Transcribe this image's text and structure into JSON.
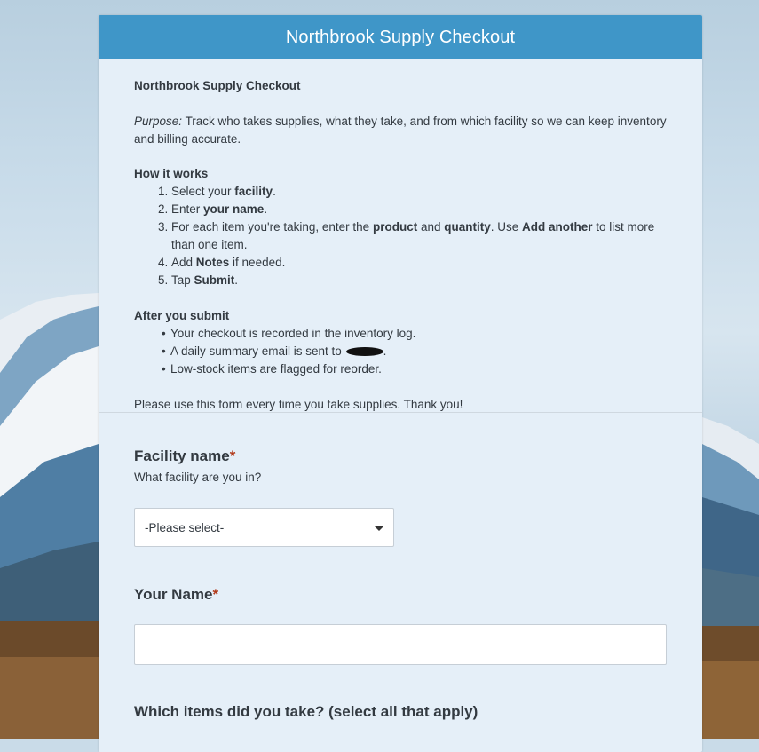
{
  "form": {
    "header_title": "Northbrook Supply Checkout",
    "intro": {
      "title": "Northbrook Supply Checkout",
      "purpose_label": "Purpose:",
      "purpose_text": "Track who takes supplies, what they take, and from which facility so we can keep inventory and billing accurate.",
      "how_title": "How it works",
      "steps": [
        {
          "pre": "Select your ",
          "bold": "facility",
          "post": "."
        },
        {
          "pre": "Enter ",
          "bold": "your name",
          "post": "."
        },
        {
          "pre": "For each item you're taking, enter the ",
          "bold": "product",
          "mid": " and ",
          "bold2": "quantity",
          "mid2": ". Use ",
          "bold3": "Add another",
          "post": " to list more than one item."
        },
        {
          "pre": "Add ",
          "bold": "Notes",
          "post": " if needed."
        },
        {
          "pre": "Tap ",
          "bold": "Submit",
          "post": "."
        }
      ],
      "after_title": "After you submit",
      "after_items": [
        "Your checkout is recorded in the inventory log.",
        "A daily summary email is sent to",
        "Low-stock items are flagged for reorder."
      ],
      "after_item2_suffix": ".",
      "thanks": "Please use this form every time you take supplies. Thank you!"
    },
    "facility": {
      "label": "Facility name",
      "required_mark": "*",
      "help": "What facility are you in?",
      "selected": "-Please select-"
    },
    "name": {
      "label": "Your Name",
      "required_mark": "*",
      "value": ""
    },
    "items": {
      "label": "Which items did you take? (select all that apply)"
    }
  }
}
